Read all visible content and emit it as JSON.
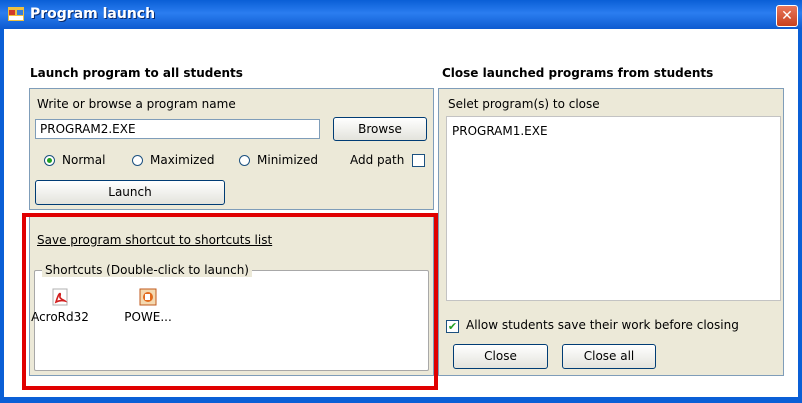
{
  "window": {
    "title": "Program launch",
    "close_glyph": "✕"
  },
  "launch": {
    "heading": "Launch program to all students",
    "prompt_label": "Write or browse  a program name",
    "program_value": "PROGRAM2.EXE",
    "browse_label": "Browse",
    "radios": [
      {
        "label": "Normal",
        "selected": true
      },
      {
        "label": "Maximized",
        "selected": false
      },
      {
        "label": "Minimized",
        "selected": false
      }
    ],
    "add_path_label": "Add path",
    "add_path_checked": false,
    "launch_label": "Launch",
    "save_shortcut_link": "Save program shortcut to shortcuts list",
    "shortcuts_legend": "Shortcuts (Double-click to launch)",
    "shortcuts": [
      {
        "label": "AcroRd32",
        "icon": "acrobat-icon"
      },
      {
        "label": "POWE...",
        "icon": "powerpoint-icon"
      }
    ]
  },
  "close": {
    "heading": "Close launched programs from students",
    "select_label": "Selet program(s) to close",
    "programs": [
      "PROGRAM1.EXE"
    ],
    "allow_save_label": "Allow students save their work before closing",
    "allow_save_checked": true,
    "close_label": "Close",
    "close_all_label": "Close all"
  },
  "colors": {
    "titlebar": "#0a5fd6",
    "highlight": "#e00000",
    "dialog": "#ece9d8"
  }
}
